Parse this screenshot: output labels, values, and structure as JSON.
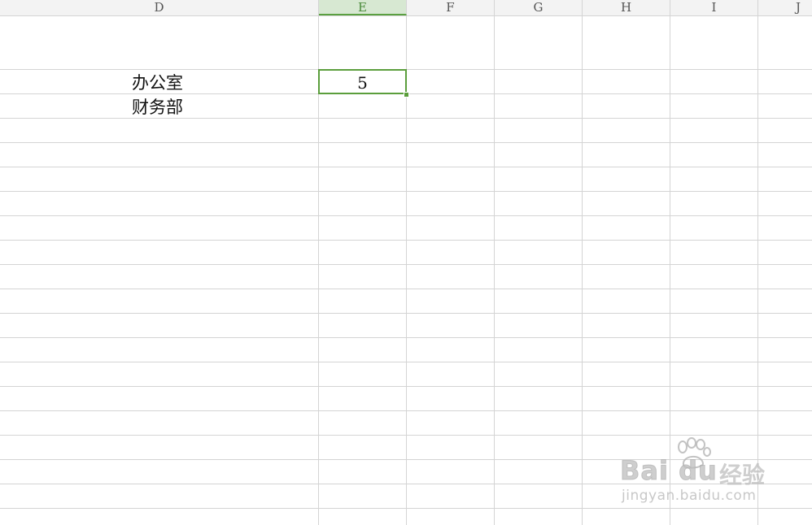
{
  "columns": [
    "D",
    "E",
    "F",
    "G",
    "H",
    "I",
    "J"
  ],
  "selected_column": "E",
  "cells": {
    "D3": "办公室",
    "D4": "财务部",
    "E3": "5"
  },
  "watermark": {
    "logo_text": "Bai du",
    "suffix_text": "经验",
    "url": "jingyan.baidu.com"
  },
  "colors": {
    "accent": "#5b9e3c",
    "grid": "#d4d4d4",
    "header_bg": "#f3f3f3",
    "selected_header_bg": "#d7e8d2"
  }
}
